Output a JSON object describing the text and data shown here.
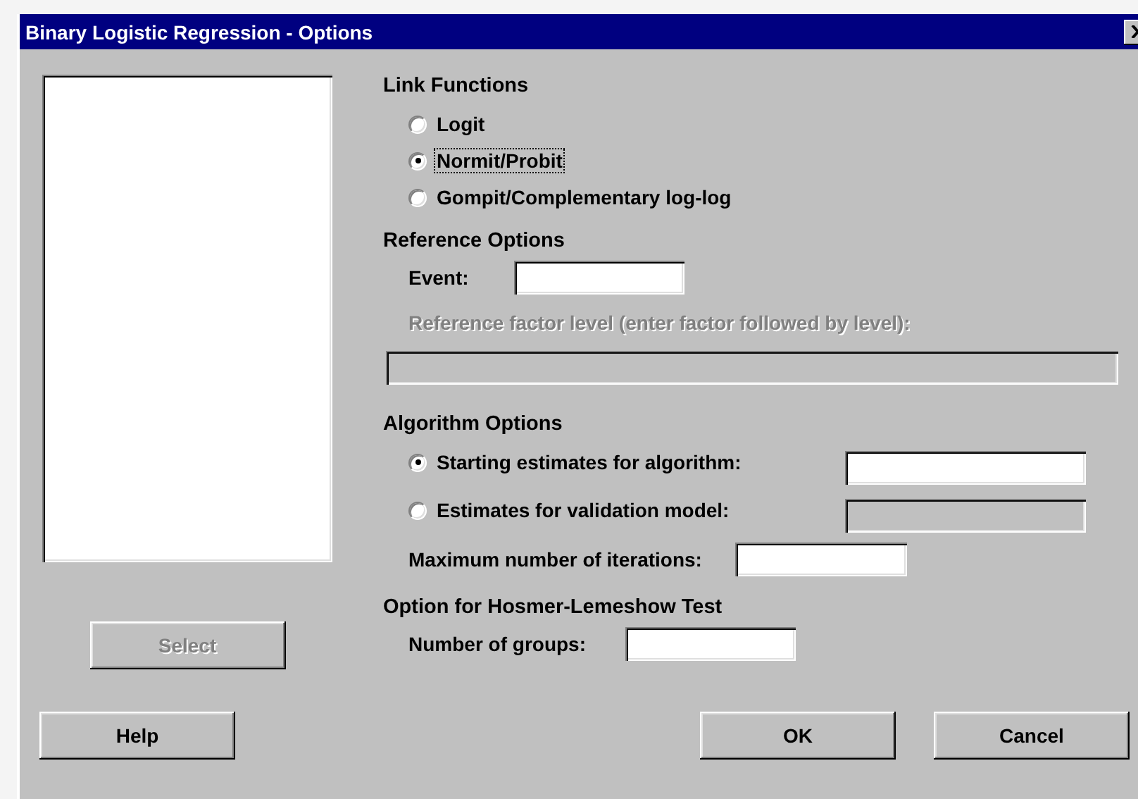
{
  "window": {
    "title": "Binary Logistic Regression - Options"
  },
  "select_button": {
    "label": "Select",
    "disabled": true
  },
  "link_functions": {
    "heading": "Link Functions",
    "options": [
      {
        "label": "Logit",
        "selected": false,
        "focused": false
      },
      {
        "label": "Normit/Probit",
        "selected": true,
        "focused": true
      },
      {
        "label": "Gompit/Complementary log-log",
        "selected": false,
        "focused": false
      }
    ]
  },
  "reference_options": {
    "heading": "Reference Options",
    "event": {
      "label": "Event:"
    },
    "reference_factor": {
      "label": "Reference factor level (enter factor followed by level):",
      "disabled": true
    }
  },
  "algorithm_options": {
    "heading": "Algorithm Options",
    "options": [
      {
        "label": "Starting estimates for algorithm:",
        "selected": true
      },
      {
        "label": "Estimates for validation model:",
        "selected": false
      }
    ],
    "max_iterations": {
      "label": "Maximum number of iterations:"
    }
  },
  "hosmer_lemeshow": {
    "heading": "Option for Hosmer-Lemeshow Test",
    "groups": {
      "label": "Number of groups:"
    }
  },
  "buttons": [
    {
      "label": "Help"
    },
    {
      "label": "OK"
    },
    {
      "label": "Cancel"
    }
  ]
}
